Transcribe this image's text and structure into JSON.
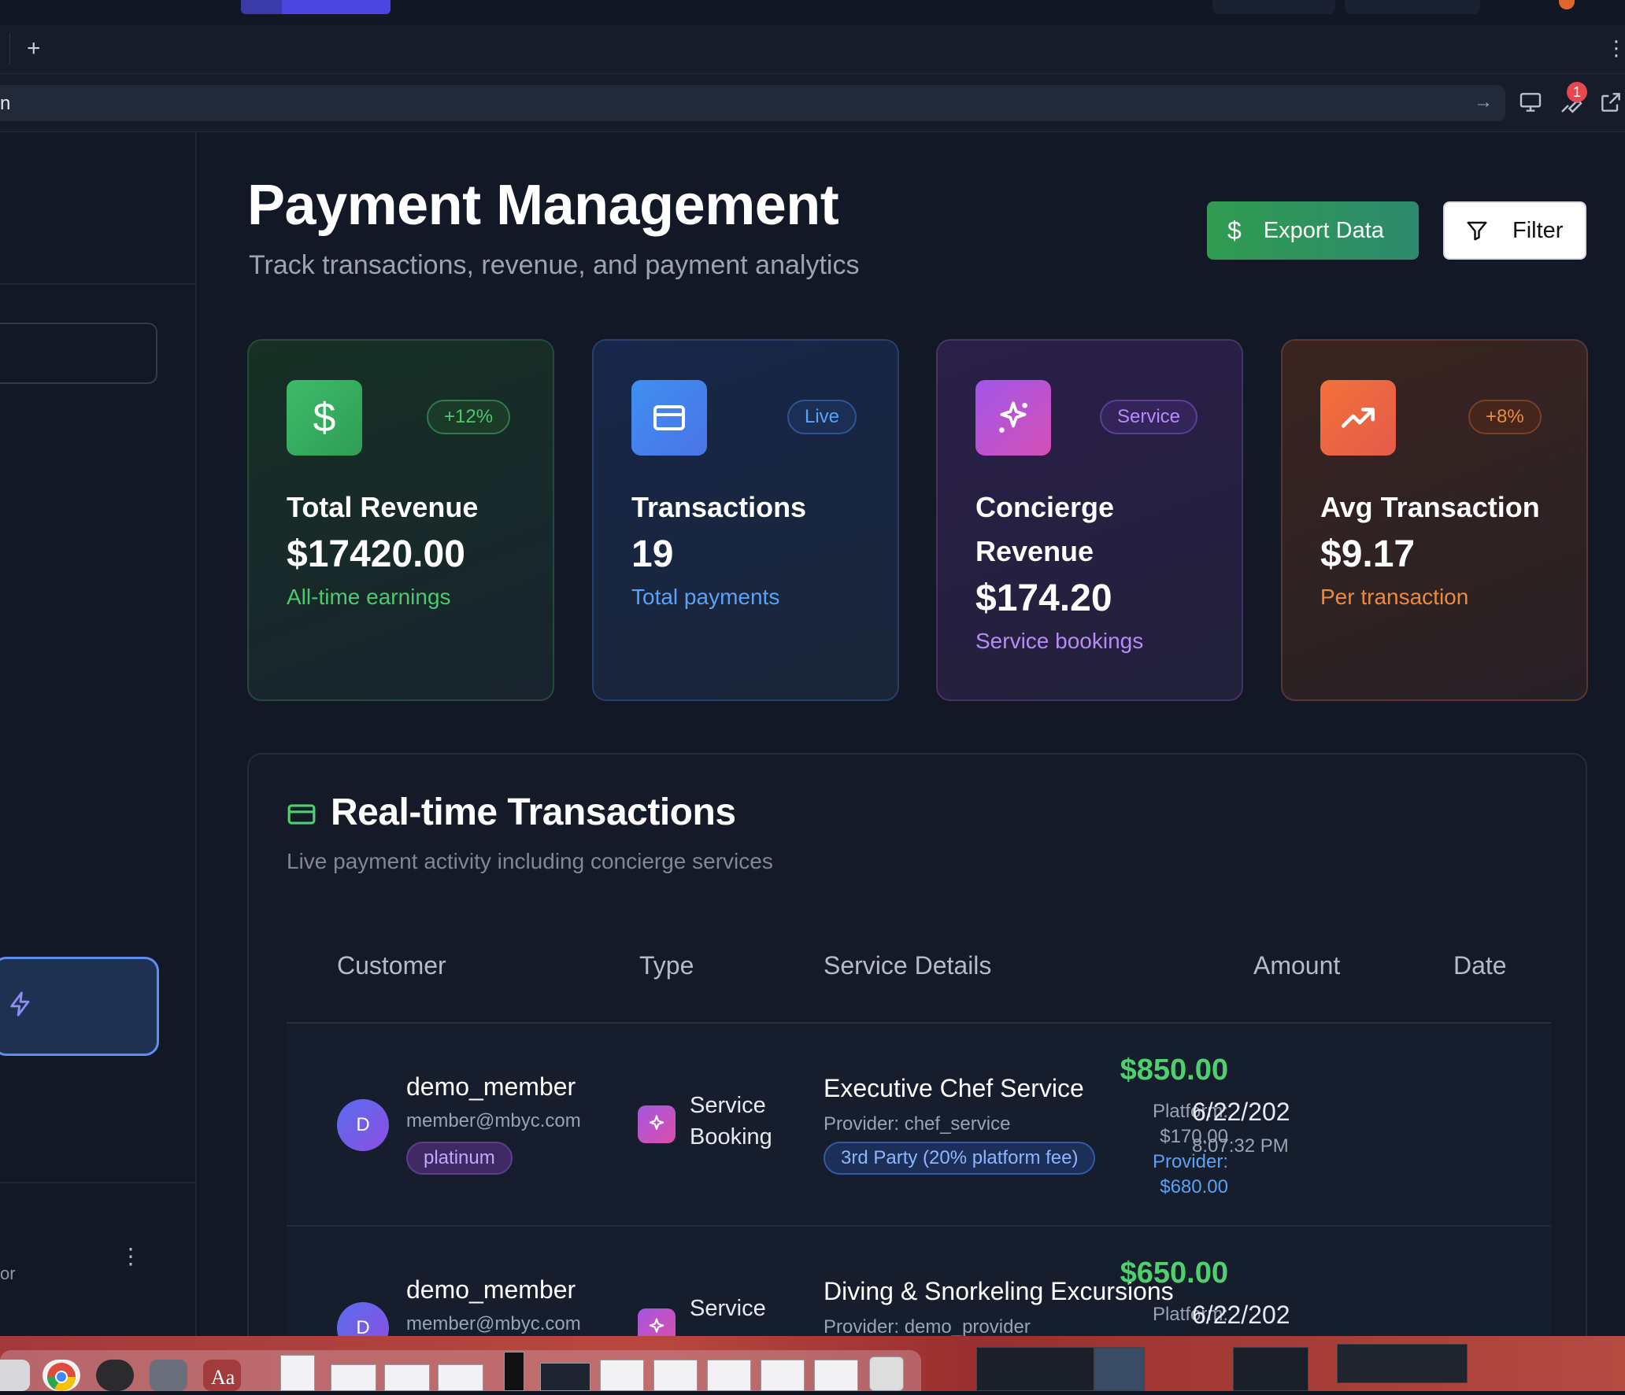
{
  "browser": {
    "new_tab": "+",
    "menu": "⋮",
    "address_fragment": "n",
    "go_arrow": "→",
    "extensions_badge": "1"
  },
  "sidebar": {
    "user_fragment": "or",
    "menu": "⋮"
  },
  "header": {
    "title": "Payment Management",
    "subtitle": "Track transactions, revenue, and payment analytics",
    "export_label": "Export Data",
    "filter_label": "Filter"
  },
  "stats": [
    {
      "icon": "dollar-icon",
      "tag": "+12%",
      "label": "Total Revenue",
      "value": "$17420.00",
      "note": "All-time earnings",
      "accent": "#4cc970"
    },
    {
      "icon": "credit-card-icon",
      "tag": "Live",
      "label": "Transactions",
      "value": "19",
      "note": "Total payments",
      "accent": "#5aa2f5"
    },
    {
      "icon": "sparkles-icon",
      "tag": "Service",
      "label": "Concierge Revenue",
      "value": "$174.20",
      "note": "Service bookings",
      "accent": "#b58cf7"
    },
    {
      "icon": "trending-up-icon",
      "tag": "+8%",
      "label": "Avg Transaction",
      "value": "$9.17",
      "note": "Per transaction",
      "accent": "#f08a3a"
    }
  ],
  "transactions": {
    "title": "Real-time Transactions",
    "subtitle": "Live payment activity including concierge services",
    "columns": [
      "Customer",
      "Type",
      "Service Details",
      "Amount",
      "Date"
    ],
    "rows": [
      {
        "avatar": "D",
        "name": "demo_member",
        "email": "member@mbyc.com",
        "tier": "platinum",
        "type_line1": "Service",
        "type_line2": "Booking",
        "service": "Executive Chef Service",
        "provider": "Provider: chef_service",
        "fee": "3rd Party (20% platform fee)",
        "amount": "$850.00",
        "platform_label": "Platform:",
        "platform_amount": "$170.00",
        "provider_label": "Provider:",
        "provider_amount": "$680.00",
        "date": "6/22/202",
        "time": "8:07:32 PM"
      },
      {
        "avatar": "D",
        "name": "demo_member",
        "email": "member@mbyc.com",
        "type_line1": "Service",
        "service": "Diving & Snorkeling Excursions",
        "provider": "Provider: demo_provider",
        "amount": "$650.00",
        "platform_label": "Platform:",
        "date": "6/22/202"
      }
    ]
  },
  "colors": {
    "green": "#4fd06e",
    "blue": "#5aa2f5",
    "purple": "#b58cf7",
    "orange": "#f08a3a",
    "background": "#121826"
  }
}
